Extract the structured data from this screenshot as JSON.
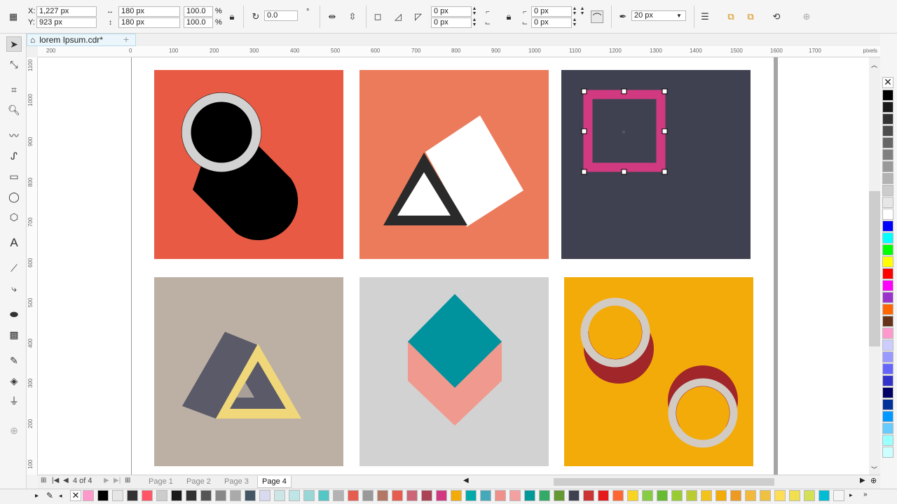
{
  "property_bar": {
    "x_label": "X:",
    "x_value": "1,227 px",
    "y_label": "Y:",
    "y_value": "923 px",
    "width_value": "180 px",
    "height_value": "180 px",
    "scale_w": "100.0",
    "scale_h": "100.0",
    "percent_sign": "%",
    "rotation": "0.0",
    "rotation_unit": "°",
    "corner_h1": "0 px",
    "corner_v1": "0 px",
    "corner_h2": "0 px",
    "corner_v2": "0 px",
    "outline_width": "20 px"
  },
  "document_tab": {
    "title": "lorem Ipsum.cdr*"
  },
  "rulers": {
    "units": "pixels",
    "h_ticks": [
      "200",
      "0",
      "100",
      "200",
      "300",
      "400",
      "500",
      "600",
      "700",
      "800",
      "900",
      "1000",
      "1100",
      "1200",
      "1300",
      "1400",
      "1500",
      "1600",
      "1700"
    ],
    "v_ticks": [
      "1100",
      "1000",
      "900",
      "800",
      "700",
      "600",
      "500",
      "400",
      "300",
      "200",
      "100"
    ]
  },
  "page_nav": {
    "counter": "4 of 4",
    "pages": [
      "Page 1",
      "Page 2",
      "Page 3",
      "Page 4"
    ],
    "active_page": "Page 4"
  },
  "colors": {
    "tile1_bg": "#e85a44",
    "tile2_bg": "#ec7b5c",
    "tile3_bg": "#3f4150",
    "tile4_bg": "#bcb0a4",
    "tile5_bg": "#d2d2d2",
    "tile6_bg": "#f3ab0a",
    "selection": "#d13a80",
    "accent": "#39b2d8"
  },
  "palette_vertical": [
    "#000000",
    "#1a1a1a",
    "#333333",
    "#4d4d4d",
    "#666666",
    "#808080",
    "#999999",
    "#b3b3b3",
    "#cccccc",
    "#e6e6e6",
    "#ffffff",
    "#0000ff",
    "#00ffff",
    "#00ff00",
    "#ffff00",
    "#ff0000",
    "#ff00ff",
    "#9933cc",
    "#ff6600",
    "#66331a",
    "#ff99cc",
    "#ccccff",
    "#9999ff",
    "#6666ff",
    "#3333cc",
    "#000066",
    "#003399",
    "#0099ff",
    "#66ccff",
    "#99ffff",
    "#ccffff"
  ],
  "palette_horizontal": [
    "#ff99cc",
    "#000000",
    "#e6e6e6",
    "#333333",
    "#ff5566",
    "#cccccc",
    "#1a1a1a",
    "#333333",
    "#555555",
    "#888888",
    "#aaaaaa",
    "#445566",
    "#d9d9f0",
    "#cce6e6",
    "#bfe6e6",
    "#99d6d6",
    "#55c6c6",
    "#b3b3b3",
    "#e65c4f",
    "#999999",
    "#b37766",
    "#e65c4f",
    "#cc6677",
    "#aa4455",
    "#d13a80",
    "#f3ab0a",
    "#00aaaa",
    "#44aabb",
    "#f0908a",
    "#f2a0a0",
    "#009999",
    "#33aa66",
    "#669933",
    "#3f4150",
    "#cc3333",
    "#e61a1a",
    "#ff6633",
    "#f9d423",
    "#88cc44",
    "#66bb33",
    "#99cc33",
    "#bbcc33",
    "#f3c31a",
    "#f3ab0a",
    "#ee9922",
    "#f4b83a",
    "#f0c040",
    "#ffdd55",
    "#f0e050",
    "#d4e157",
    "#00bcd4",
    "#f5f5f5"
  ]
}
